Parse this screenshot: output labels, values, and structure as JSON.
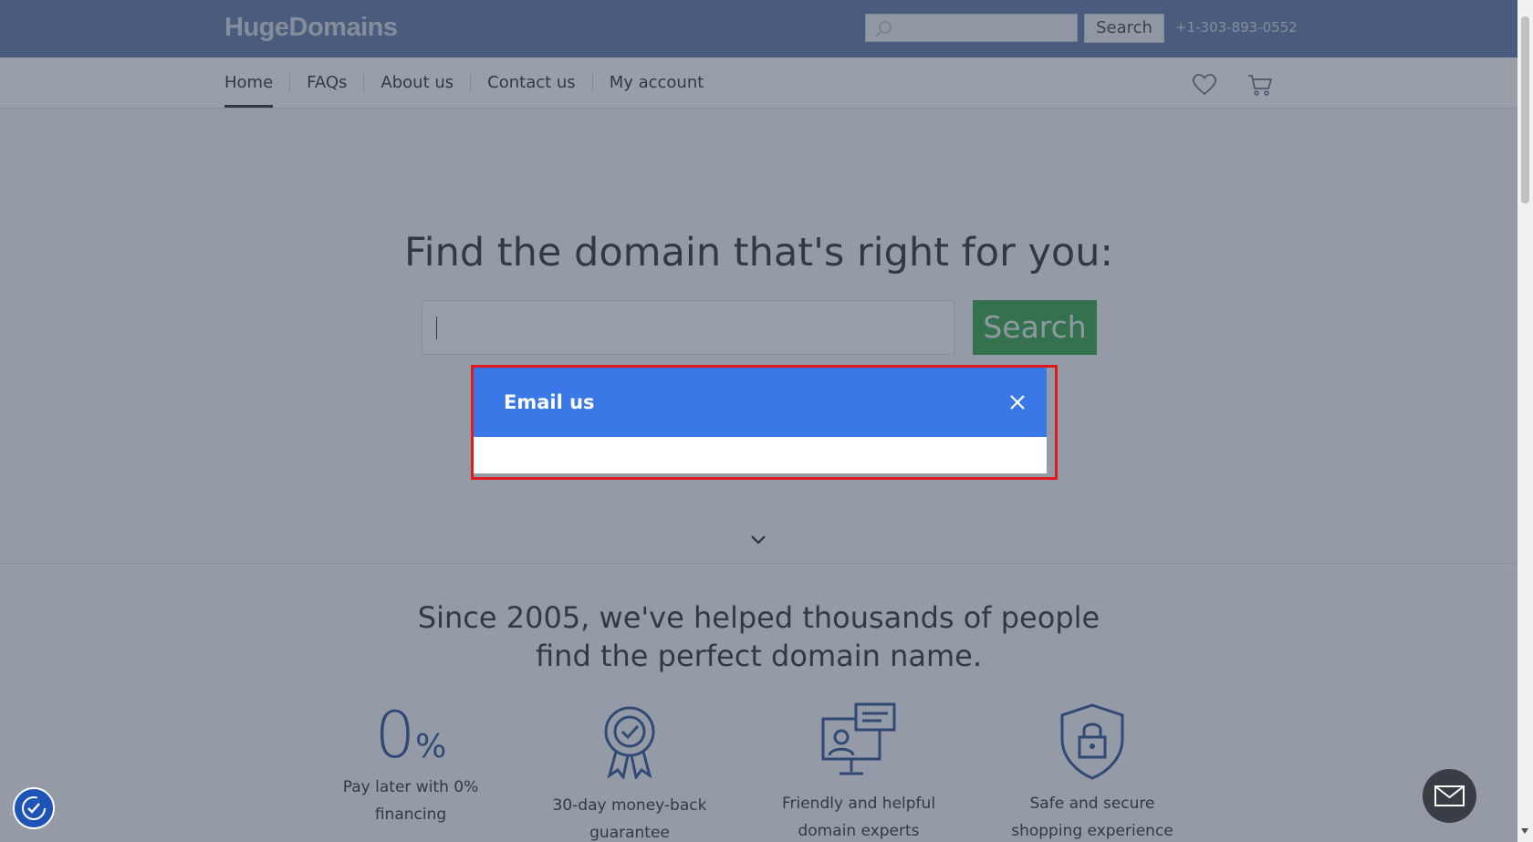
{
  "header": {
    "logo": "HugeDomains",
    "search_placeholder": "",
    "search_button": "Search",
    "phone": "+1-303-893-0552"
  },
  "nav": {
    "items": [
      {
        "label": "Home",
        "active": true
      },
      {
        "label": "FAQs",
        "active": false
      },
      {
        "label": "About us",
        "active": false
      },
      {
        "label": "Contact us",
        "active": false
      },
      {
        "label": "My account",
        "active": false
      }
    ],
    "icons": [
      "heart-icon",
      "cart-icon"
    ]
  },
  "hero": {
    "title": "Find the domain that's right for you:",
    "search_value": "",
    "search_button": "Search"
  },
  "since": {
    "heading_line1": "Since 2005, we've helped thousands of people",
    "heading_line2": "find the perfect domain name.",
    "features": [
      {
        "icon": "zero-percent-icon",
        "line1": "Pay later with 0%",
        "line2": "financing",
        "badge_digit": "0",
        "badge_symbol": "%"
      },
      {
        "icon": "award-ribbon-icon",
        "line1": "30-day money-back",
        "line2": "guarantee"
      },
      {
        "icon": "expert-support-icon",
        "line1": "Friendly and helpful",
        "line2": "domain experts"
      },
      {
        "icon": "security-shield-icon",
        "line1": "Safe and secure",
        "line2": "shopping experience"
      }
    ]
  },
  "modal": {
    "title": "Email us"
  },
  "colors": {
    "header_bg": "#5e79a6",
    "search_green": "#33a24a",
    "modal_header": "#3b78e7",
    "modal_outline": "#e01b1b",
    "accessibility_blue": "#1e54b7"
  }
}
